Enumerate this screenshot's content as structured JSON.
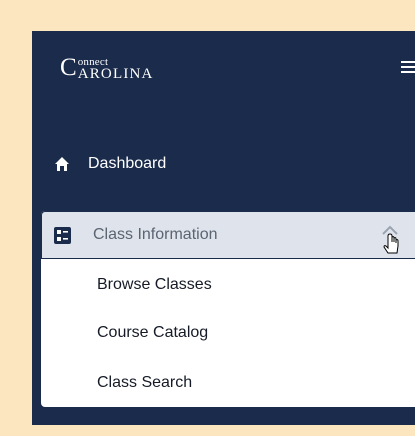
{
  "brand": {
    "connect": "onnect",
    "c": "C",
    "carolina": "AROLINA"
  },
  "nav": {
    "dashboard_label": "Dashboard",
    "class_info_label": "Class Information",
    "submenu": [
      {
        "label": "Browse Classes"
      },
      {
        "label": "Course Catalog"
      },
      {
        "label": "Class Search"
      }
    ]
  },
  "colors": {
    "panel": "#1b2b4b",
    "page_bg": "#fbe6bf",
    "selected_bg": "#dfe4ec"
  },
  "icons": [
    "menu-icon",
    "home-icon",
    "class-info-icon",
    "chevron-up-icon",
    "hand-cursor-icon"
  ]
}
